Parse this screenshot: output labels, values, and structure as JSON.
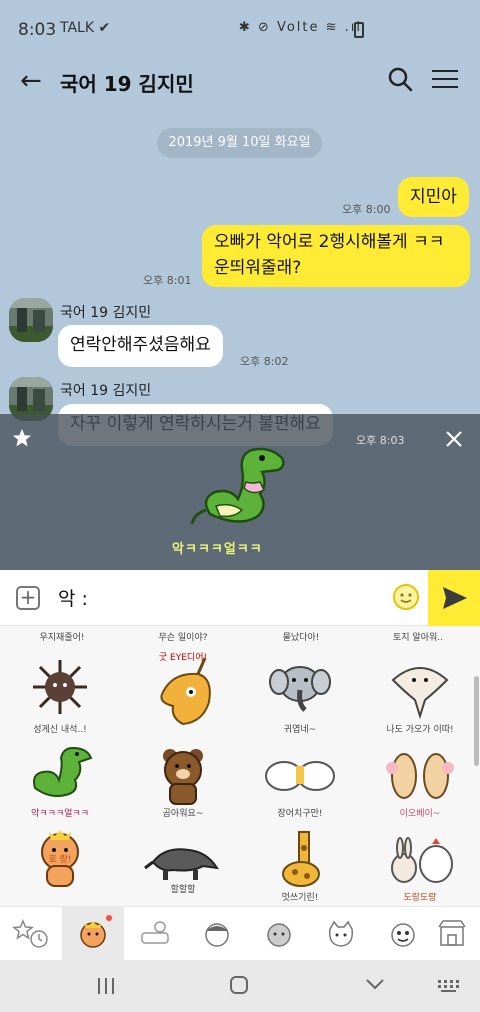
{
  "status": {
    "time": "8:03",
    "left_icons": "TALK ✔",
    "right_icons": "✱ ⊘ Volte ≋ .ıl"
  },
  "header": {
    "back_icon": "arrow-left-icon",
    "title": "국어 19 김지민",
    "search_icon": "search-icon",
    "menu_icon": "hamburger-icon"
  },
  "chat": {
    "date": "2019년 9월 10일 화요일",
    "messages": [
      {
        "from": "me",
        "text": "지민아",
        "time": "오후 8:00"
      },
      {
        "from": "me",
        "text_line1": "오빠가 악어로 2행시해볼게 ㅋㅋ",
        "text_line2": "운띄워줄래?",
        "time": "오후 8:01"
      },
      {
        "from": "them",
        "sender": "국어 19 김지민",
        "text": "연락안해주셨음해요",
        "time": "오후 8:02"
      },
      {
        "from": "them",
        "sender": "국어 19 김지민",
        "text": "자꾸 이렇게 연락하시는거 불편해요",
        "time": "오후 8:03"
      }
    ]
  },
  "sticker_preview": {
    "caption": "악ㅋㅋㅋ얼ㅋㅋ"
  },
  "input": {
    "text": "악 :"
  },
  "sticker_grid": {
    "top_captions": [
      "우지재줄어!",
      "무슨 일이야?",
      "물났다아!",
      "토지 알아워.."
    ],
    "rows": [
      [
        "성게신 내석..!",
        "굿 EYE디어!",
        "귀엽네~",
        "나도 가오가 이따!"
      ],
      [
        "악ㅋㅋㅋ얼ㅋㅋ",
        "곰아워요~",
        "장어치구만!",
        "이오베이~"
      ],
      [
        "호 랑!",
        "할할할",
        "멋쓰기린!",
        "도랑도랑"
      ]
    ]
  },
  "colors": {
    "chat_bg": "#b2c7da",
    "my_bubble": "#ffeb33",
    "their_bubble": "#ffffff",
    "accent": "#ffeb33"
  }
}
